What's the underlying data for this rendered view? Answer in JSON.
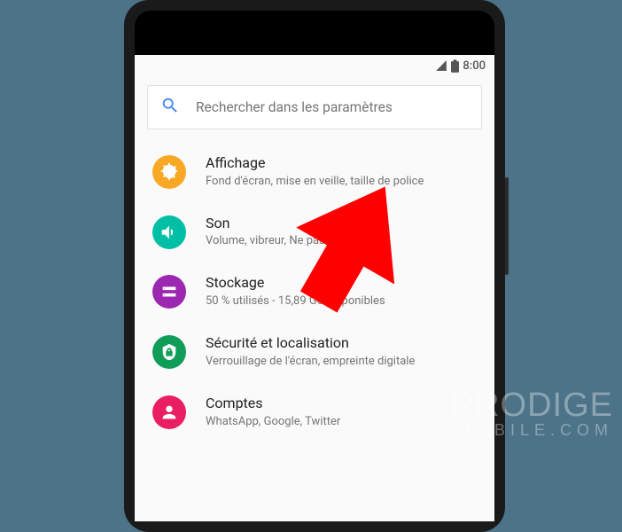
{
  "status": {
    "time": "8:00"
  },
  "search": {
    "placeholder": "Rechercher dans les paramètres"
  },
  "settings": [
    {
      "icon": "display",
      "color": "#f9a825",
      "title": "Affichage",
      "sub": "Fond d'écran, mise en veille, taille de police"
    },
    {
      "icon": "sound",
      "color": "#00bfa5",
      "title": "Son",
      "sub": "Volume, vibreur, Ne pas déranger"
    },
    {
      "icon": "storage",
      "color": "#9c27b0",
      "title": "Stockage",
      "sub": "50 % utilisés - 15,89 Go disponibles"
    },
    {
      "icon": "security",
      "color": "#0f9d58",
      "title": "Sécurité et localisation",
      "sub": "Verrouillage de l'écran, empreinte digitale"
    },
    {
      "icon": "accounts",
      "color": "#e91e63",
      "title": "Comptes",
      "sub": "WhatsApp, Google, Twitter"
    }
  ],
  "watermark": {
    "line1": "PRODIGE",
    "line2": "MOBILE.COM"
  }
}
